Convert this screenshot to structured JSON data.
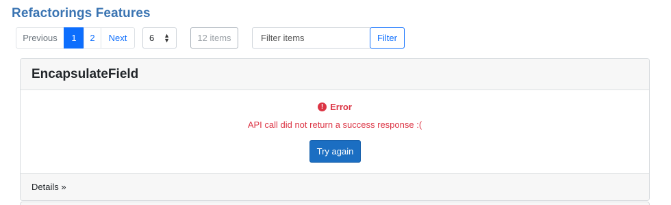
{
  "page": {
    "title": "Refactorings Features"
  },
  "pager": {
    "previous_label": "Previous",
    "pages": [
      "1",
      "2"
    ],
    "active_page": "1",
    "next_label": "Next"
  },
  "page_size": {
    "selected": "6"
  },
  "items_count": "12 items",
  "filter": {
    "placeholder": "Filter items",
    "value": "",
    "button_label": "Filter"
  },
  "card": {
    "title": "EncapsulateField",
    "error_title": "Error",
    "error_message": "API call did not return a success response :(",
    "retry_label": "Try again",
    "footer_label": "Details »"
  },
  "colors": {
    "title": "#3a74b2",
    "primary": "#0d6efd",
    "error": "#dc3545",
    "retry_button": "#1b6ec2"
  },
  "icons": {
    "error": "exclamation-circle-icon",
    "select_caret": "up-down-caret-icon"
  }
}
